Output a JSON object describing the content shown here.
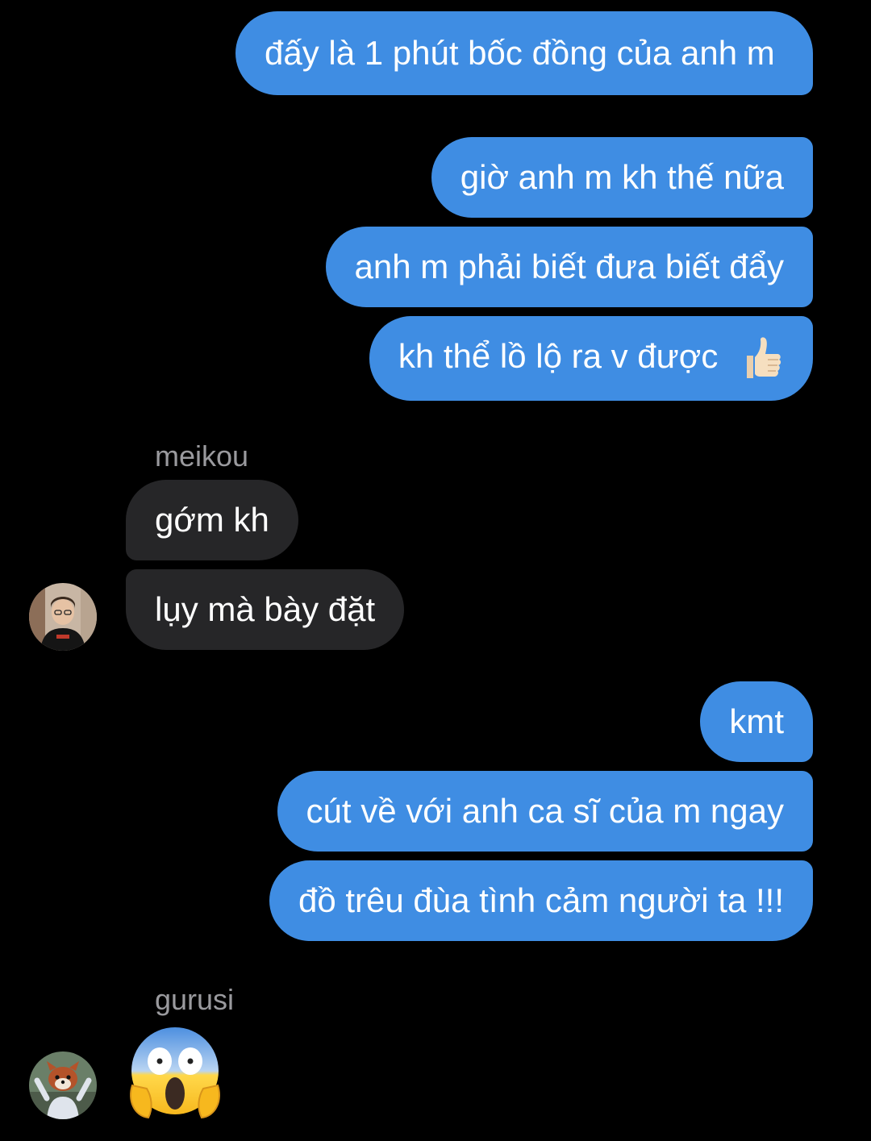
{
  "messages": {
    "m1": "đấy là 1 phút bốc đồng của anh m",
    "m2": "giờ anh m kh thế nữa",
    "m3": "anh m phải biết đưa biết đẩy",
    "m4": "kh thể lồ lộ ra v được",
    "m4_emoji": "thumbs-up-icon",
    "sender1": "meikou",
    "m5": "gớm kh",
    "m6": "lụy mà bày đặt",
    "m7": "kmt",
    "m8": "cút về với anh ca sĩ của m ngay",
    "m9": "đồ trêu đùa tình cảm người ta !!!",
    "sender2": "gurusi",
    "m10_emoji": "face-screaming-in-fear-icon"
  },
  "colors": {
    "background": "#000000",
    "outgoing_bubble": "#3f8de3",
    "incoming_bubble": "#262628",
    "sender_name": "#9a9a9e"
  }
}
